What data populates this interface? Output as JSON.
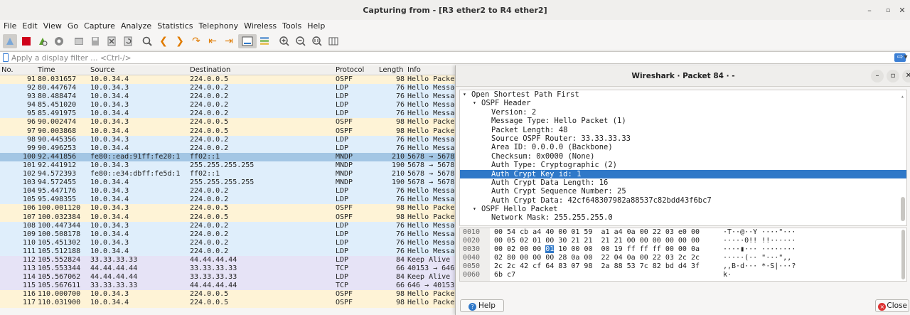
{
  "window": {
    "title": "Capturing from - [R3 ether2 to R4 ether2]"
  },
  "menu": [
    "File",
    "Edit",
    "View",
    "Go",
    "Capture",
    "Analyze",
    "Statistics",
    "Telephony",
    "Wireless",
    "Tools",
    "Help"
  ],
  "filter": {
    "placeholder": "Apply a display filter … <Ctrl-/>"
  },
  "packet_list": {
    "columns": [
      "No.",
      "Time",
      "Source",
      "Destination",
      "Protocol",
      "Length",
      "Info"
    ],
    "rows": [
      {
        "no": "91",
        "time": "80.031657",
        "src": "10.0.34.4",
        "dst": "224.0.0.5",
        "proto": "OSPF",
        "len": "98",
        "info": "Hello Packet",
        "cls": "ospf"
      },
      {
        "no": "92",
        "time": "80.447674",
        "src": "10.0.34.3",
        "dst": "224.0.0.2",
        "proto": "LDP",
        "len": "76",
        "info": "Hello Message",
        "cls": "ldp"
      },
      {
        "no": "93",
        "time": "80.488474",
        "src": "10.0.34.4",
        "dst": "224.0.0.2",
        "proto": "LDP",
        "len": "76",
        "info": "Hello Message",
        "cls": "ldp"
      },
      {
        "no": "94",
        "time": "85.451020",
        "src": "10.0.34.3",
        "dst": "224.0.0.2",
        "proto": "LDP",
        "len": "76",
        "info": "Hello Message",
        "cls": "ldp"
      },
      {
        "no": "95",
        "time": "85.491975",
        "src": "10.0.34.4",
        "dst": "224.0.0.2",
        "proto": "LDP",
        "len": "76",
        "info": "Hello Message",
        "cls": "ldp"
      },
      {
        "no": "96",
        "time": "90.002474",
        "src": "10.0.34.3",
        "dst": "224.0.0.5",
        "proto": "OSPF",
        "len": "98",
        "info": "Hello Packet",
        "cls": "ospf"
      },
      {
        "no": "97",
        "time": "90.003868",
        "src": "10.0.34.4",
        "dst": "224.0.0.5",
        "proto": "OSPF",
        "len": "98",
        "info": "Hello Packet",
        "cls": "ospf"
      },
      {
        "no": "98",
        "time": "90.445356",
        "src": "10.0.34.3",
        "dst": "224.0.0.2",
        "proto": "LDP",
        "len": "76",
        "info": "Hello Message",
        "cls": "ldp"
      },
      {
        "no": "99",
        "time": "90.496253",
        "src": "10.0.34.4",
        "dst": "224.0.0.2",
        "proto": "LDP",
        "len": "76",
        "info": "Hello Message",
        "cls": "ldp"
      },
      {
        "no": "100",
        "time": "92.441856",
        "src": "fe80::ead:91ff:fe20:1",
        "dst": "ff02::1",
        "proto": "MNDP",
        "len": "210",
        "info": "5678 → 5678",
        "cls": "sel"
      },
      {
        "no": "101",
        "time": "92.441912",
        "src": "10.0.34.3",
        "dst": "255.255.255.255",
        "proto": "MNDP",
        "len": "190",
        "info": "5678 → 5678",
        "cls": "mndp"
      },
      {
        "no": "102",
        "time": "94.572393",
        "src": "fe80::e34:dbff:fe5d:1",
        "dst": "ff02::1",
        "proto": "MNDP",
        "len": "210",
        "info": "5678 → 5678",
        "cls": "mndp"
      },
      {
        "no": "103",
        "time": "94.572455",
        "src": "10.0.34.4",
        "dst": "255.255.255.255",
        "proto": "MNDP",
        "len": "190",
        "info": "5678 → 5678",
        "cls": "mndp"
      },
      {
        "no": "104",
        "time": "95.447176",
        "src": "10.0.34.3",
        "dst": "224.0.0.2",
        "proto": "LDP",
        "len": "76",
        "info": "Hello Message",
        "cls": "ldp"
      },
      {
        "no": "105",
        "time": "95.498355",
        "src": "10.0.34.4",
        "dst": "224.0.0.2",
        "proto": "LDP",
        "len": "76",
        "info": "Hello Message",
        "cls": "ldp"
      },
      {
        "no": "106",
        "time": "100.001120",
        "src": "10.0.34.3",
        "dst": "224.0.0.5",
        "proto": "OSPF",
        "len": "98",
        "info": "Hello Packet",
        "cls": "ospf"
      },
      {
        "no": "107",
        "time": "100.032384",
        "src": "10.0.34.4",
        "dst": "224.0.0.5",
        "proto": "OSPF",
        "len": "98",
        "info": "Hello Packet",
        "cls": "ospf"
      },
      {
        "no": "108",
        "time": "100.447344",
        "src": "10.0.34.3",
        "dst": "224.0.0.2",
        "proto": "LDP",
        "len": "76",
        "info": "Hello Message",
        "cls": "ldp"
      },
      {
        "no": "109",
        "time": "100.508178",
        "src": "10.0.34.4",
        "dst": "224.0.0.2",
        "proto": "LDP",
        "len": "76",
        "info": "Hello Message",
        "cls": "ldp"
      },
      {
        "no": "110",
        "time": "105.451302",
        "src": "10.0.34.3",
        "dst": "224.0.0.2",
        "proto": "LDP",
        "len": "76",
        "info": "Hello Message",
        "cls": "ldp"
      },
      {
        "no": "111",
        "time": "105.512188",
        "src": "10.0.34.4",
        "dst": "224.0.0.2",
        "proto": "LDP",
        "len": "76",
        "info": "Hello Message",
        "cls": "ldp"
      },
      {
        "no": "112",
        "time": "105.552824",
        "src": "33.33.33.33",
        "dst": "44.44.44.44",
        "proto": "LDP",
        "len": "84",
        "info": "Keep Alive",
        "cls": "tcp"
      },
      {
        "no": "113",
        "time": "105.553344",
        "src": "44.44.44.44",
        "dst": "33.33.33.33",
        "proto": "TCP",
        "len": "66",
        "info": "40153 → 646",
        "cls": "tcp"
      },
      {
        "no": "114",
        "time": "105.567062",
        "src": "44.44.44.44",
        "dst": "33.33.33.33",
        "proto": "LDP",
        "len": "84",
        "info": "Keep Alive",
        "cls": "tcp"
      },
      {
        "no": "115",
        "time": "105.567611",
        "src": "33.33.33.33",
        "dst": "44.44.44.44",
        "proto": "TCP",
        "len": "66",
        "info": "646 → 40153",
        "cls": "tcp"
      },
      {
        "no": "116",
        "time": "110.000700",
        "src": "10.0.34.3",
        "dst": "224.0.0.5",
        "proto": "OSPF",
        "len": "98",
        "info": "Hello Packet",
        "cls": "ospf"
      },
      {
        "no": "117",
        "time": "110.031900",
        "src": "10.0.34.4",
        "dst": "224.0.0.5",
        "proto": "OSPF",
        "len": "98",
        "info": "Hello Packet",
        "cls": "ospf"
      }
    ]
  },
  "dialog": {
    "title": "Wireshark · Packet 84 · -",
    "tree": [
      {
        "text": "Open Shortest Path First",
        "indent": 0,
        "arrow": "▾"
      },
      {
        "text": "OSPF Header",
        "indent": 1,
        "arrow": "▾"
      },
      {
        "text": "Version: 2",
        "indent": 2
      },
      {
        "text": "Message Type: Hello Packet (1)",
        "indent": 2
      },
      {
        "text": "Packet Length: 48",
        "indent": 2
      },
      {
        "text": "Source OSPF Router: 33.33.33.33",
        "indent": 2
      },
      {
        "text": "Area ID: 0.0.0.0 (Backbone)",
        "indent": 2
      },
      {
        "text": "Checksum: 0x0000 (None)",
        "indent": 2
      },
      {
        "text": "Auth Type: Cryptographic (2)",
        "indent": 2
      },
      {
        "text": "Auth Crypt Key id: 1",
        "indent": 2,
        "sel": true
      },
      {
        "text": "Auth Crypt Data Length: 16",
        "indent": 2
      },
      {
        "text": "Auth Crypt Sequence Number: 25",
        "indent": 2
      },
      {
        "text": "Auth Crypt Data: 42cf648307982a88537c82bdd43f6bc7",
        "indent": 2
      },
      {
        "text": "OSPF Hello Packet",
        "indent": 1,
        "arrow": "▾"
      },
      {
        "text": "Network Mask: 255.255.255.0",
        "indent": 2
      }
    ],
    "hex": [
      {
        "off": "0010",
        "pre": "00 54 cb a4 40 00 01 59  a1 a4 0a 00 22 03 e0 00",
        "hi": "",
        "post": "",
        "asc": "·T··@··Y ····\"···"
      },
      {
        "off": "0020",
        "pre": "00 05 02 01 00 30 21 21  21 21 00 00 00 00 00 00",
        "hi": "",
        "post": "",
        "asc": "·····0!! !!······"
      },
      {
        "off": "0030",
        "pre": "00 02 00 00 ",
        "hi": "01",
        "post": " 10 00 00  00 19 ff ff ff 00 00 0a",
        "asc": "····▮··· ········"
      },
      {
        "off": "0040",
        "pre": "02 80 00 00 00 28 0a 00  22 04 0a 00 22 03 2c 2c",
        "hi": "",
        "post": "",
        "asc": "·····(·· \"···\",,"
      },
      {
        "off": "0050",
        "pre": "2c 2c 42 cf 64 83 07 98  2a 88 53 7c 82 bd d4 3f",
        "hi": "",
        "post": "",
        "asc": ",,B·d··· *·S|···?"
      },
      {
        "off": "0060",
        "pre": "6b c7",
        "hi": "",
        "post": "",
        "asc": "k·"
      }
    ],
    "help_label": "Help",
    "close_label": "Close"
  }
}
